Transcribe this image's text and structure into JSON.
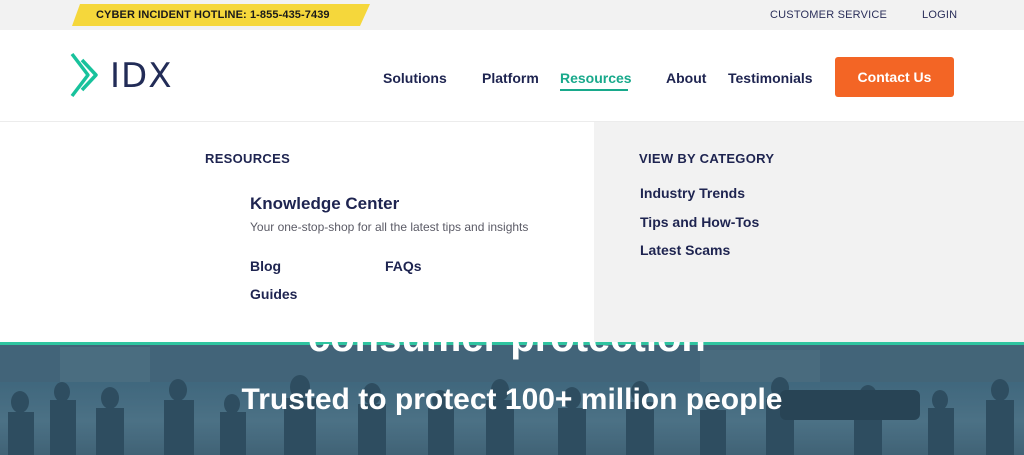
{
  "topbar": {
    "hotline": "CYBER INCIDENT HOTLINE: 1-855-435-7439",
    "customer_service": "CUSTOMER SERVICE",
    "login": "LOGIN",
    "hotline_color": "#f5d73b"
  },
  "header": {
    "logo_text": "IDX",
    "nav": {
      "solutions": "Solutions",
      "platform": "Platform",
      "resources": "Resources",
      "about": "About",
      "testimonials": "Testimonials"
    },
    "active_nav": "Resources",
    "contact_label": "Contact Us",
    "accent_color": "#18a98b",
    "cta_color": "#f36525"
  },
  "mega_menu": {
    "resources_heading": "RESOURCES",
    "knowledge_center": {
      "title": "Knowledge Center",
      "description": "Your one-stop-shop for all the latest tips and insights"
    },
    "links": {
      "blog": "Blog",
      "faqs": "FAQs",
      "guides": "Guides"
    },
    "category_heading": "VIEW BY CATEGORY",
    "categories": [
      "Industry Trends",
      "Tips and How-Tos",
      "Latest Scams"
    ]
  },
  "hero": {
    "heading_partial": "consumer protection",
    "subheading": "Trusted to protect 100+ million people"
  }
}
